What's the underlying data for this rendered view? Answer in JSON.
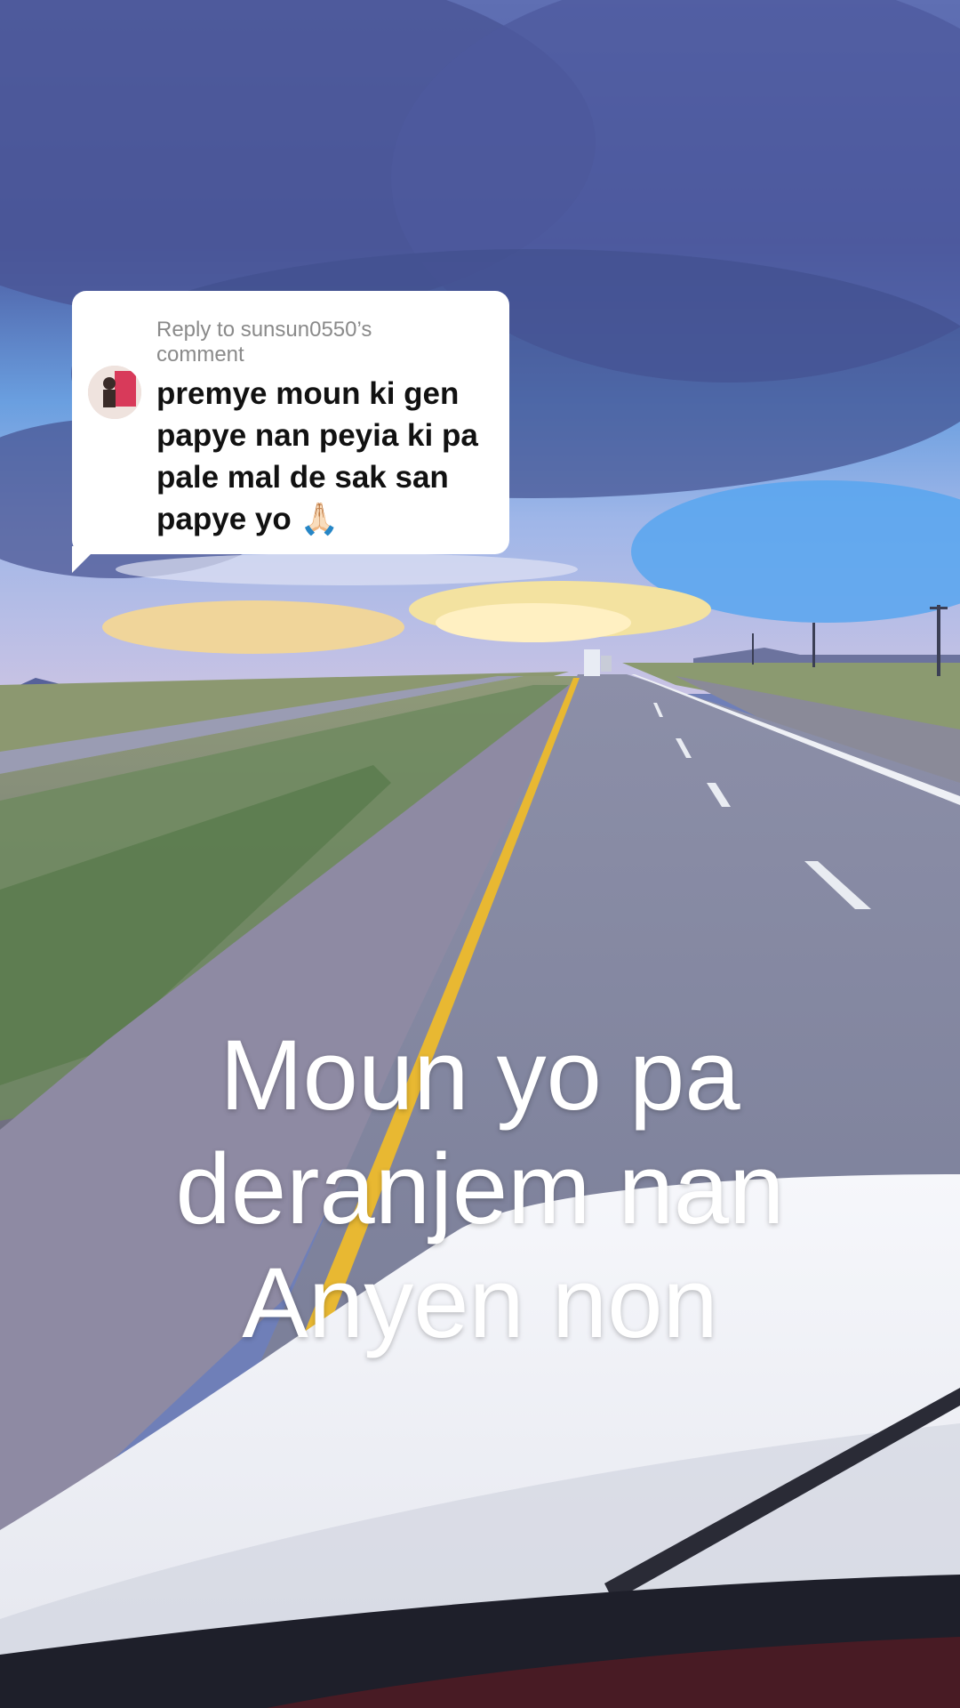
{
  "reply": {
    "header_line1": "Reply to sunsun0550’s",
    "header_line2": "comment",
    "text": "premye moun ki gen papye nan peyia ki pa pale mal de sak san papye yo",
    "emoji": "🙏🏻"
  },
  "overlay": {
    "line1": "Moun yo pa",
    "line2": "deranjem nan",
    "line3": "Anyen non"
  }
}
